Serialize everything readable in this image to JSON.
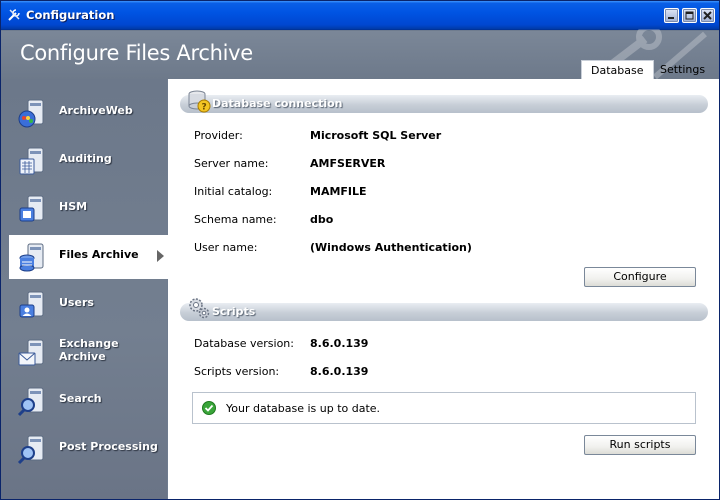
{
  "window": {
    "title": "Configuration"
  },
  "header": {
    "title": "Configure Files Archive"
  },
  "tabs": [
    {
      "label": "Database",
      "active": true
    },
    {
      "label": "Settings",
      "active": false
    }
  ],
  "sidebar": {
    "items": [
      {
        "label": "ArchiveWeb",
        "icon": "archiveweb-icon"
      },
      {
        "label": "Auditing",
        "icon": "auditing-icon"
      },
      {
        "label": "HSM",
        "icon": "hsm-icon"
      },
      {
        "label": "Files Archive",
        "icon": "files-archive-icon",
        "active": true
      },
      {
        "label": "Users",
        "icon": "users-icon"
      },
      {
        "label": "Exchange Archive",
        "icon": "exchange-archive-icon"
      },
      {
        "label": "Search",
        "icon": "search-icon"
      },
      {
        "label": "Post Processing",
        "icon": "post-processing-icon"
      }
    ]
  },
  "database": {
    "section_title": "Database connection",
    "fields": [
      {
        "label": "Provider:",
        "value": "Microsoft SQL Server"
      },
      {
        "label": "Server name:",
        "value": "AMFSERVER"
      },
      {
        "label": "Initial catalog:",
        "value": "MAMFILE"
      },
      {
        "label": "Schema name:",
        "value": "dbo"
      },
      {
        "label": "User name:",
        "value": "(Windows Authentication)"
      }
    ],
    "configure_label": "Configure"
  },
  "scripts": {
    "section_title": "Scripts",
    "fields": [
      {
        "label": "Database version:",
        "value": "8.6.0.139"
      },
      {
        "label": "Scripts version:",
        "value": "8.6.0.139"
      }
    ],
    "status_text": "Your database is up to date.",
    "run_label": "Run scripts"
  },
  "colors": {
    "titlebar": "#0054e3",
    "sidebar": "#6f7c8f",
    "status_ok": "#3aa53a"
  }
}
